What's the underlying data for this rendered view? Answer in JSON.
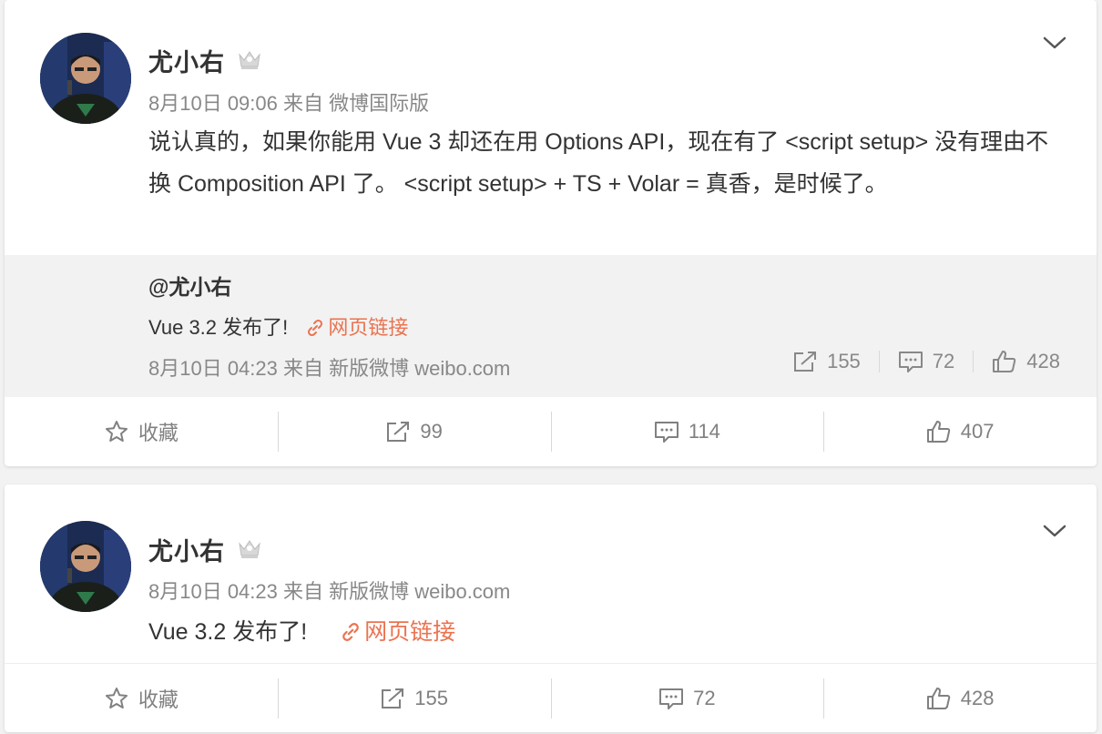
{
  "post1": {
    "username": "尤小右",
    "meta": "8月10日 09:06 来自 微博国际版",
    "text": "说认真的，如果你能用 Vue 3 却还在用 Options API，现在有了 <script setup> 没有理由不换 Composition API 了。  <script setup> + TS + Volar = 真香，是时候了。",
    "repost": {
      "user": "@尤小右",
      "text": "Vue 3.2 发布了!",
      "link_label": "网页链接",
      "meta": "8月10日 04:23 来自 新版微博 weibo.com",
      "share_count": "155",
      "comment_count": "72",
      "like_count": "428"
    },
    "toolbar": {
      "favorite_label": "收藏",
      "share_count": "99",
      "comment_count": "114",
      "like_count": "407"
    }
  },
  "post2": {
    "username": "尤小右",
    "meta": "8月10日 04:23 来自 新版微博 weibo.com",
    "text": "Vue 3.2 发布了!",
    "link_label": "网页链接",
    "toolbar": {
      "favorite_label": "收藏",
      "share_count": "155",
      "comment_count": "72",
      "like_count": "428"
    }
  },
  "colors": {
    "link": "#eb7350",
    "meta": "#888888",
    "background": "#f2f2f2"
  }
}
